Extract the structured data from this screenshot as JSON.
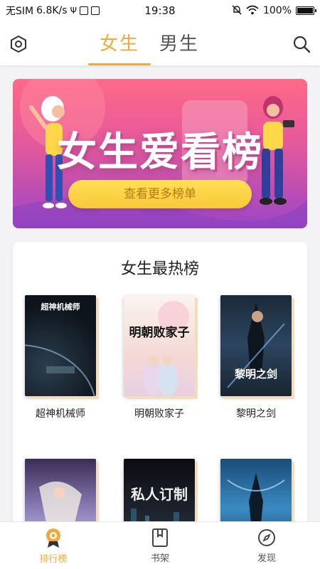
{
  "status_bar": {
    "carrier": "无SIM",
    "speed": "6.8K/s",
    "time": "19:38",
    "battery": "100%"
  },
  "header": {
    "tabs": [
      {
        "label": "女生",
        "active": true
      },
      {
        "label": "男生",
        "active": false
      }
    ],
    "left_icon": "hexagon-settings-icon",
    "right_icon": "search-icon",
    "accent_color": "#f2a93b"
  },
  "banner": {
    "title": "女生爱看榜",
    "button_label": "查看更多榜单"
  },
  "rank_section": {
    "title": "女生最热榜",
    "books": [
      {
        "name": "超神机械师",
        "cover_text": "超神机械师"
      },
      {
        "name": "明朝败家子",
        "cover_text": "明朝败家子"
      },
      {
        "name": "黎明之剑",
        "cover_text": "黎明之剑"
      },
      {
        "name": "",
        "cover_text": ""
      },
      {
        "name": "",
        "cover_text": "私人订制"
      },
      {
        "name": "",
        "cover_text": ""
      }
    ]
  },
  "bottom_nav": [
    {
      "label": "排行榜",
      "icon": "ranking-medal-icon",
      "active": true
    },
    {
      "label": "书架",
      "icon": "bookshelf-icon",
      "active": false
    },
    {
      "label": "发现",
      "icon": "compass-icon",
      "active": false
    }
  ]
}
